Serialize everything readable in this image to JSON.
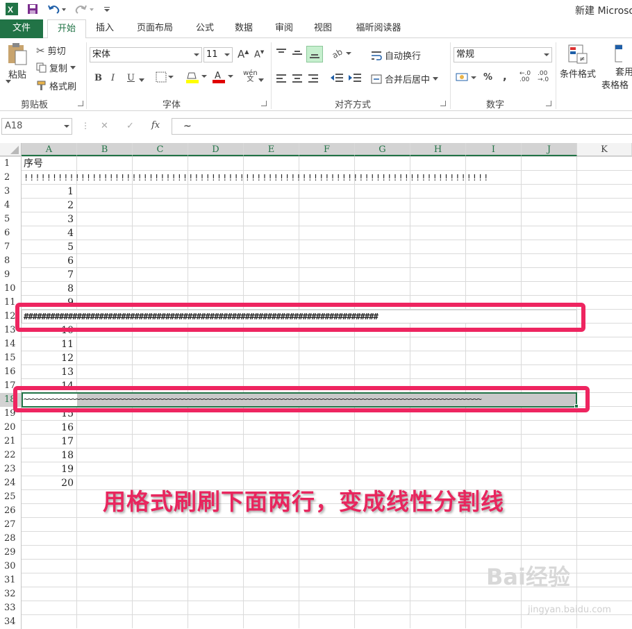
{
  "title_bar": {
    "title": "新建 Microso",
    "undo_icon": "undo-icon",
    "redo_icon": "redo-icon"
  },
  "tabs": [
    {
      "label": "文件"
    },
    {
      "label": "开始"
    },
    {
      "label": "插入"
    },
    {
      "label": "页面布局"
    },
    {
      "label": "公式"
    },
    {
      "label": "数据"
    },
    {
      "label": "审阅"
    },
    {
      "label": "视图"
    },
    {
      "label": "福昕阅读器"
    }
  ],
  "ribbon": {
    "clipboard": {
      "paste": "粘贴",
      "cut": "剪切",
      "copy": "复制",
      "format_painter": "格式刷",
      "group_label": "剪贴板"
    },
    "font": {
      "font_name": "宋体",
      "font_size": "11",
      "bold": "B",
      "italic": "I",
      "underline": "U",
      "phonetic": "wén",
      "group_label": "字体"
    },
    "alignment": {
      "wrap_text": "自动换行",
      "merge_center": "合并后居中",
      "group_label": "对齐方式"
    },
    "number": {
      "format": "常规",
      "percent": "%",
      "comma": ",",
      "group_label": "数字"
    },
    "styles": {
      "conditional_format": "条件格式",
      "table_format_line1": "套用",
      "table_format_line2": "表格格"
    }
  },
  "formula_bar": {
    "name_box": "A18",
    "cancel": "✕",
    "enter": "✓",
    "fx": "fx",
    "content": "~"
  },
  "columns": [
    "A",
    "B",
    "C",
    "D",
    "E",
    "F",
    "G",
    "H",
    "I",
    "J",
    "K"
  ],
  "rows": [
    "1",
    "2",
    "3",
    "4",
    "5",
    "6",
    "7",
    "8",
    "9",
    "10",
    "11",
    "12",
    "13",
    "14",
    "15",
    "16",
    "17",
    "18",
    "19",
    "20",
    "21",
    "22",
    "23",
    "24",
    "25",
    "26",
    "27",
    "28",
    "29",
    "30",
    "31",
    "32",
    "33",
    "34"
  ],
  "cells": {
    "A1": "序号",
    "row2_fill": "!!!!!!!!!!!!!!!!!!!!!!!!!!!!!!!!!!!!!!!!!!!!!!!!!!!!!!!!!!!!!!!!!!!!!!!!!!!!!!!!!!",
    "row12_fill": "################################################################################",
    "row18_fill": "~~~~~~~~~~~~~~~~~~~~~~~~~~~~~~~~~~~~~~~~~~~~~~~~~~~~~~~~~~~~~~~~~~~~~~~~~~~~~~~~~~~~~~~~~~~~~~~~~~~~~~~~~~~~~~~~~~~",
    "numbers": [
      {
        "row": 3,
        "value": "1"
      },
      {
        "row": 4,
        "value": "2"
      },
      {
        "row": 5,
        "value": "3"
      },
      {
        "row": 6,
        "value": "4"
      },
      {
        "row": 7,
        "value": "5"
      },
      {
        "row": 8,
        "value": "6"
      },
      {
        "row": 9,
        "value": "7"
      },
      {
        "row": 10,
        "value": "8"
      },
      {
        "row": 11,
        "value": "9"
      },
      {
        "row": 13,
        "value": "10"
      },
      {
        "row": 14,
        "value": "11"
      },
      {
        "row": 15,
        "value": "12"
      },
      {
        "row": 16,
        "value": "13"
      },
      {
        "row": 17,
        "value": "14"
      },
      {
        "row": 19,
        "value": "15"
      },
      {
        "row": 20,
        "value": "16"
      },
      {
        "row": 21,
        "value": "17"
      },
      {
        "row": 22,
        "value": "18"
      },
      {
        "row": 23,
        "value": "19"
      },
      {
        "row": 24,
        "value": "20"
      }
    ]
  },
  "annotation": "用格式刷刷下面两行，变成线性分割线",
  "watermark": {
    "main": "Bai经验",
    "sub": "jingyan.baidu.com"
  },
  "colors": {
    "excel_green": "#217346",
    "highlight_red": "#ee2560",
    "annotation_pink": "#e8265e"
  }
}
